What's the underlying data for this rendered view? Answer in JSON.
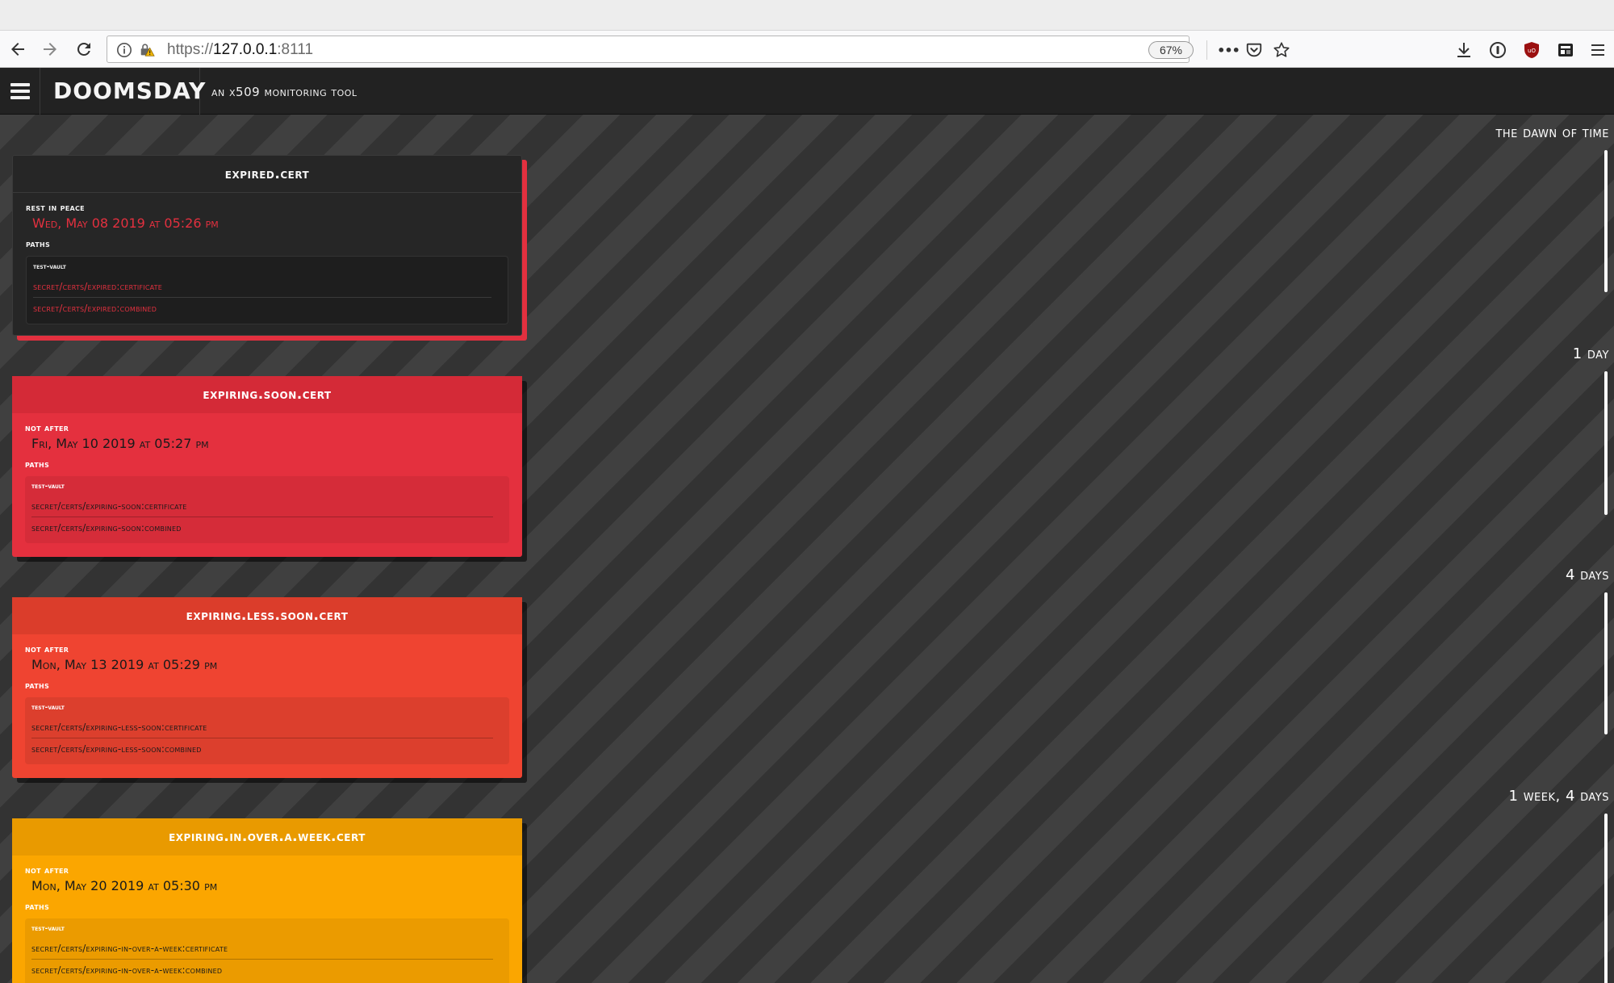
{
  "browser": {
    "url_scheme": "https://",
    "url_host": "127.0.0.1",
    "url_port": ":8111",
    "zoom": "67%",
    "more_label": "•••"
  },
  "app": {
    "title": "DOOMSDAY",
    "tagline": "an x509 monitoring tool"
  },
  "timeline": [
    {
      "label": "the dawn of time"
    },
    {
      "label": "1 day"
    },
    {
      "label": "4 days"
    },
    {
      "label": "1 week, 4 days"
    }
  ],
  "certs": [
    {
      "name": "expired.cert",
      "date_label": "rest in peace",
      "date": "Wed, May 08 2019 at 05:26 pm",
      "paths_label": "paths",
      "vault": "test-vault",
      "paths": [
        "secret/certs/expired:certificate",
        "secret/certs/expired:combined"
      ]
    },
    {
      "name": "expiring.soon.cert",
      "date_label": "not after",
      "date": "Fri, May 10 2019 at 05:27 pm",
      "paths_label": "paths",
      "vault": "test-vault",
      "paths": [
        "secret/certs/expiring-soon:certificate",
        "secret/certs/expiring-soon:combined"
      ]
    },
    {
      "name": "expiring.less.soon.cert",
      "date_label": "not after",
      "date": "Mon, May 13 2019 at 05:29 pm",
      "paths_label": "paths",
      "vault": "test-vault",
      "paths": [
        "secret/certs/expiring-less-soon:certificate",
        "secret/certs/expiring-less-soon:combined"
      ]
    },
    {
      "name": "expiring.in.over.a.week.cert",
      "date_label": "not after",
      "date": "Mon, May 20 2019 at 05:30 pm",
      "paths_label": "paths",
      "vault": "test-vault",
      "paths": [
        "secret/certs/expiring-in-over-a-week:certificate",
        "secret/certs/expiring-in-over-a-week:combined"
      ]
    }
  ],
  "colors": {
    "expired": "#262626",
    "red": "#e4303e",
    "orange": "#ef4431",
    "amber": "#fba600",
    "header": "#222222"
  }
}
